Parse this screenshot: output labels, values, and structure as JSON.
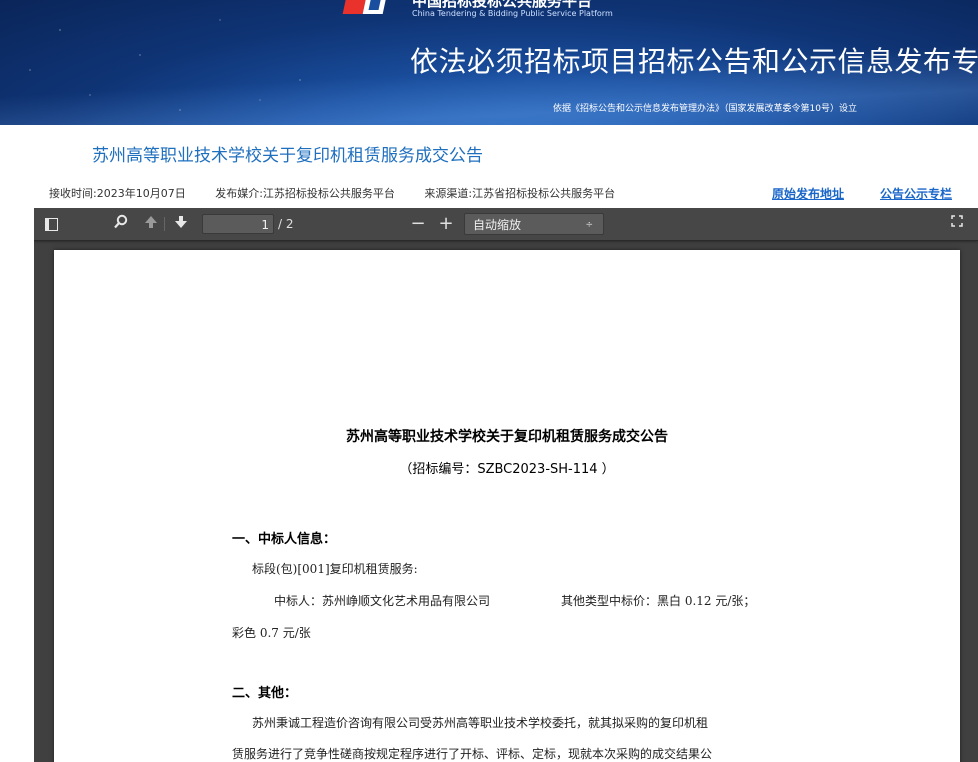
{
  "banner": {
    "platform_name": "中国招标投标公共服务平台",
    "platform_en": "China Tendering & Bidding Public Service Platform",
    "title": "依法必须招标项目招标公告和公示信息发布专栏",
    "subtitle": "依据《招标公告和公示信息发布管理办法》（国家发展改革委令第10号）设立"
  },
  "article": {
    "title": "苏州高等职业技术学校关于复印机租赁服务成交公告",
    "meta": {
      "received": "接收时间:2023年10月07日",
      "media": "发布媒介:江苏招标投标公共服务平台",
      "source": "来源渠道:江苏省招标投标公共服务平台"
    },
    "links": {
      "original": "原始发布地址",
      "column": "公告公示专栏"
    }
  },
  "viewer": {
    "page_current": "1",
    "page_total": "/ 2",
    "zoom_minus": "−",
    "zoom_plus": "+",
    "zoom_label": "自动缩放",
    "zoom_arrow": "÷"
  },
  "document": {
    "title": "苏州高等职业技术学校关于复印机租赁服务成交公告",
    "number": "（招标编号：SZBC2023-SH-114 ）",
    "section1_heading": "一、中标人信息：",
    "lot": "标段(包)[001]复印机租赁服务:",
    "winner": "中标人：苏州峥顺文化艺术用品有限公司",
    "price": "其他类型中标价：黑白 0.12 元/张；",
    "price_cont": "彩色 0.7 元/张",
    "section2_heading": "二、其他：",
    "other_p1": "苏州秉诚工程造价咨询有限公司受苏州高等职业技术学校委托，就其拟采购的复印机租",
    "other_p2": "赁服务进行了竞争性磋商按规定程序进行了开标、评标、定标，现就本次采购的成交结果公"
  },
  "colors": {
    "link": "#1a66c9",
    "title": "#1f6fbf",
    "toolbar": "#474747",
    "viewer_bg": "#404040"
  }
}
